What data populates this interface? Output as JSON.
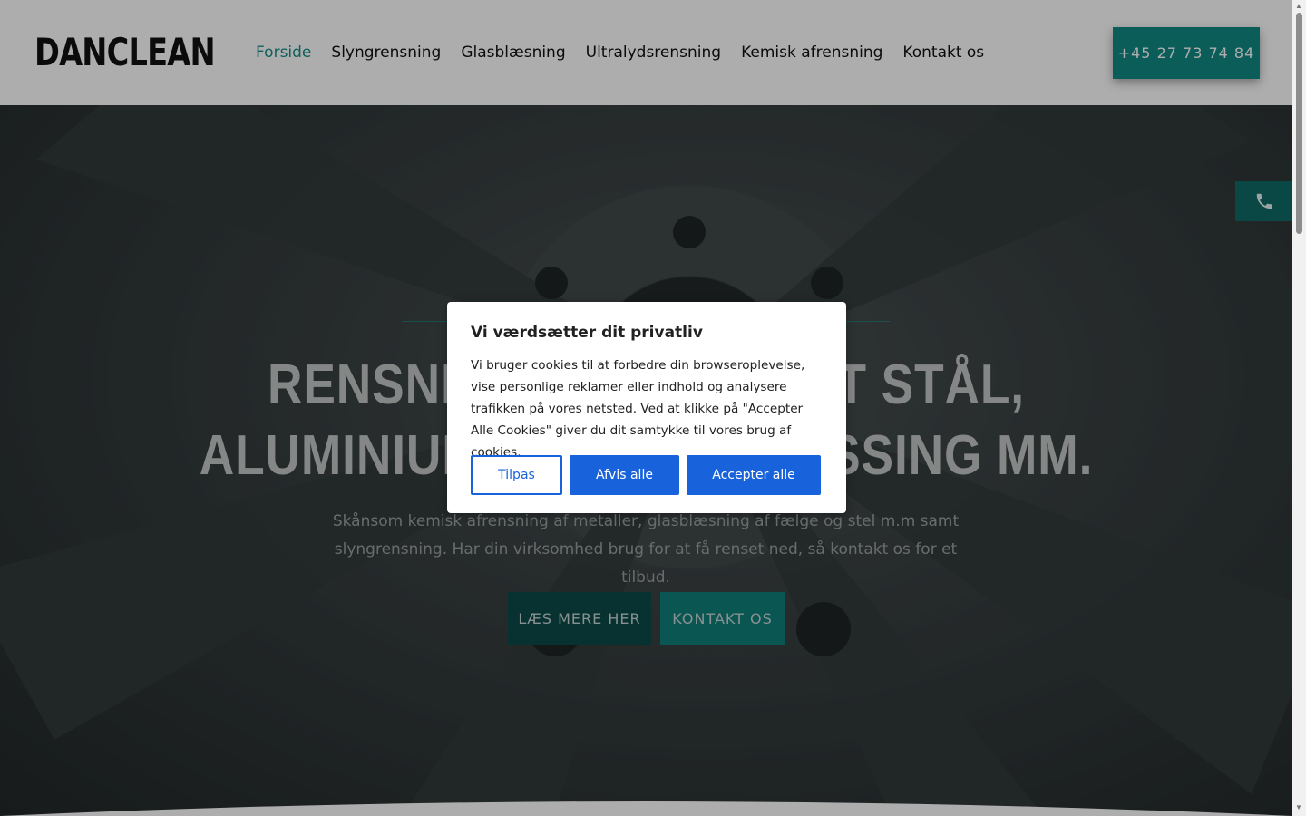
{
  "header": {
    "logo": "DANCLEAN",
    "nav": [
      {
        "label": "Forside",
        "active": true
      },
      {
        "label": "Slyngrensning",
        "active": false
      },
      {
        "label": "Glasblæsning",
        "active": false
      },
      {
        "label": "Ultralydsrensning",
        "active": false
      },
      {
        "label": "Kemisk afrensning",
        "active": false
      },
      {
        "label": "Kontakt os",
        "active": false
      }
    ],
    "phone_button": "+45 27 73 74 84"
  },
  "hero": {
    "title_line1": "RENSNING AF RUSTFRIT STÅL,",
    "title_line2": "ALUMINIUM, KOBBER, MESSING MM.",
    "subtitle": "Skånsom kemisk afrensning af metaller, glasblæsning af fælge og stel m.m samt slyngrensning. Har din virksomhed brug for at få renset ned, så kontakt os for et tilbud.",
    "button_read_more": "LÆS MERE HER",
    "button_contact": "KONTAKT OS",
    "side_icon": "phone-icon"
  },
  "cookie_modal": {
    "title": "Vi værdsætter dit privatliv",
    "text": "Vi bruger cookies til at forbedre din browseroplevelse, vise personlige reklamer eller indhold og analysere trafikken på vores netsted. Ved at klikke på \"Accepter Alle Cookies\" giver du dit samtykke til vores brug af cookies.",
    "customize": "Tilpas",
    "reject": "Afvis alle",
    "accept": "Accepter alle"
  },
  "colors": {
    "accent": "#0f8a84",
    "nav_active": "#17908a",
    "cookie_blue": "#1863dc"
  }
}
